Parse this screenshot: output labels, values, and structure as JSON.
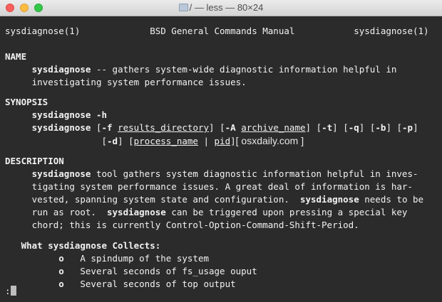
{
  "window": {
    "title": "/ — less — 80×24",
    "buttons": [
      "close",
      "minimize",
      "zoom"
    ],
    "title_icon": "folder-icon"
  },
  "man": {
    "header_left": "sysdiagnose(1)",
    "header_center": "BSD General Commands Manual",
    "header_right": "sysdiagnose(1)",
    "name_heading": "NAME",
    "name_cmd": "sysdiagnose",
    "name_line1_rest": " -- gathers system-wide diagnostic information helpful in",
    "name_line2": "investigating system performance issues.",
    "synopsis_heading": "SYNOPSIS",
    "syn1_cmd": "sysdiagnose",
    "syn1_opt": " -h",
    "syn2_cmd": "sysdiagnose",
    "syn2_p1": " [",
    "syn2_f": "-f",
    "syn2_p2": " ",
    "syn2_arg1": "results_directory",
    "syn2_p3": "] [",
    "syn2_A": "-A",
    "syn2_p4": " ",
    "syn2_arg2": "archive_name",
    "syn2_p5": "] [",
    "syn2_t": "-t",
    "syn2_p6": "] [",
    "syn2_q": "-q",
    "syn2_p7": "] [",
    "syn2_b": "-b",
    "syn2_p8": "] [",
    "syn2_p": "-p",
    "syn2_p9": "]",
    "syn3_p1": "[",
    "syn3_d": "-d",
    "syn3_p2": "] [",
    "syn3_arg1": "process_name",
    "syn3_sep": " | ",
    "syn3_arg2": "pid",
    "syn3_p3": "]",
    "watermark": "[ osxdaily.com ]",
    "description_heading": "DESCRIPTION",
    "d1_cmd": "sysdiagnose",
    "d1_rest": " tool gathers system diagnostic information helpful in inves-",
    "d2": "tigating system performance issues. A great deal of information is har-",
    "d3_pre": "vested, spanning system state and configuration.  ",
    "d3_cmd": "sysdiagnose",
    "d3_rest": " needs to be",
    "d4_pre": "run as root.  ",
    "d4_cmd": "sysdiagnose",
    "d4_rest": " can be triggered upon pressing a special key",
    "d5": "chord; this is currently Control-Option-Command-Shift-Period.",
    "collects_heading": "What sysdiagnose Collects:",
    "bullet": "o",
    "items": [
      "A spindump of the system",
      "Several seconds of fs_usage ouput",
      "Several seconds of top output"
    ],
    "prompt": ":"
  }
}
